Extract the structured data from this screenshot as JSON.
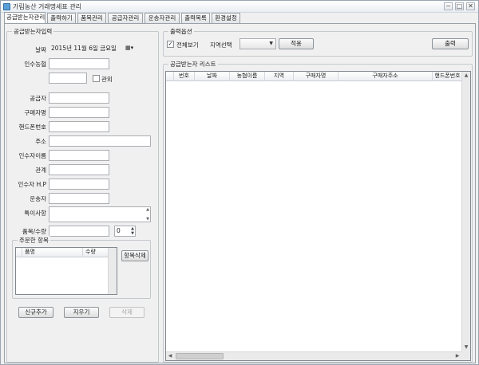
{
  "window": {
    "title": "가림농산 거래명세표 관리",
    "minimize_glyph": "−",
    "maximize_glyph": "□",
    "close_glyph": "✕"
  },
  "tabs": [
    {
      "label": "공급받는자관리",
      "active": true
    },
    {
      "label": "출력하기"
    },
    {
      "label": "품목관리"
    },
    {
      "label": "공급자관리"
    },
    {
      "label": "운송자관리"
    },
    {
      "label": "출력목록"
    },
    {
      "label": "환경설정"
    }
  ],
  "input_group": {
    "title": "공급받는자입력",
    "date_label": "날짜",
    "date_value": "2015년  11월   6일  금요일",
    "date_picker_glyph": "▦▾",
    "hanong_label": "인수농협",
    "checkbox_label": "관외",
    "supplier_label": "공급자",
    "buyer_label": "구매자명",
    "phone_label": "핸드폰번호",
    "address_label": "주소",
    "receiver_label": "인수자이름",
    "relation_label": "관계",
    "receiver_phone_label": "인수자 H.P",
    "transporter_label": "운송자",
    "notes_label": "특이사항",
    "item_qty_label": "품목/수량",
    "qty_value": "0",
    "ordered_group_title": "주문한 항목",
    "ordered_columns": [
      "품명",
      "수량"
    ],
    "delete_item_button": "항목삭제",
    "add_button": "신규추가",
    "clear_button": "지우기",
    "delete_button": "삭제"
  },
  "output_options": {
    "title": "출력옵션",
    "view_all_label": "전체보기",
    "view_all_checked": true,
    "region_label": "지역선택",
    "apply_button": "적용",
    "print_button": "출력"
  },
  "list_group": {
    "title": "공급받는자 리스트",
    "columns": [
      "번호",
      "날짜",
      "농협이름",
      "지역",
      "구매자명",
      "구매자주소",
      "핸드폰번호"
    ]
  },
  "icons": [
    "app-icon",
    "minimize-icon",
    "maximize-icon",
    "close-icon",
    "calendar-dropdown-icon",
    "checkmark-icon",
    "dropdown-arrow-icon",
    "spinner-up-icon",
    "spinner-down-icon",
    "scroll-up-icon",
    "scroll-down-icon",
    "scroll-left-icon",
    "scroll-right-icon"
  ]
}
